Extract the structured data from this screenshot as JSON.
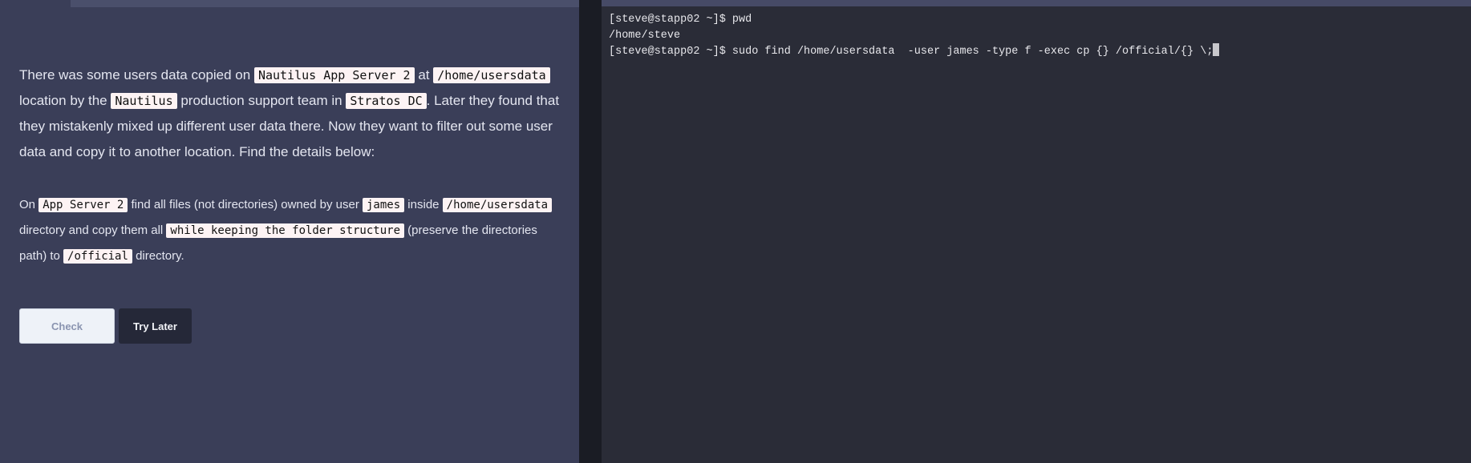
{
  "task": {
    "p1": {
      "t1": "There was some users data copied on ",
      "c1": "Nautilus App Server 2",
      "t2": " at ",
      "c2": "/home/usersdata",
      "t3": " location by the ",
      "c3": "Nautilus",
      "t4": " production support team in ",
      "c4": "Stratos DC",
      "t5": ". Later they found that they mistakenly mixed up different user data there. Now they want to filter out some user data and copy it to another location. Find the details below:"
    },
    "p2": {
      "t1": "On ",
      "c1": "App Server 2",
      "t2": " find all files (not directories) owned by user ",
      "c2": "james",
      "t3": " inside ",
      "c3": "/home/usersdata",
      "t4": " directory and copy them all ",
      "c4": "while keeping the folder structure",
      "t5": " (preserve the directories path) to ",
      "c5": "/official",
      "t6": " directory."
    }
  },
  "buttons": {
    "check": "Check",
    "try_later": "Try Later"
  },
  "terminal": {
    "lines": [
      "[steve@stapp02 ~]$ pwd",
      "/home/steve",
      "[steve@stapp02 ~]$ sudo find /home/usersdata  -user james -type f -exec cp {} /official/{} \\;"
    ]
  }
}
